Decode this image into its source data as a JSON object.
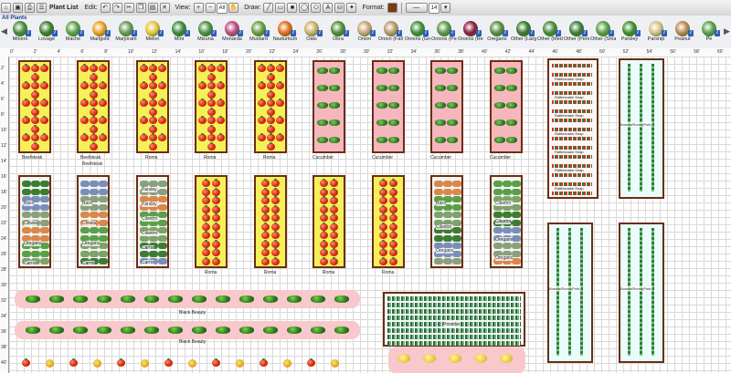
{
  "toolbar": {
    "plant_list": "Plant List",
    "edit_label": "Edit:",
    "view_label": "View:",
    "zoom_value": "All",
    "draw_label": "Draw:",
    "format_label": "Format:",
    "line_width": "14"
  },
  "palette": {
    "filter": "All Plants",
    "items": [
      {
        "label": "Miners",
        "color": "#4b8b3b"
      },
      {
        "label": "Lovage",
        "color": "#3f7f2f"
      },
      {
        "label": "Mache",
        "color": "#5fa04a"
      },
      {
        "label": "Marigold",
        "color": "#f0a020"
      },
      {
        "label": "Marjoram",
        "color": "#6b9a55"
      },
      {
        "label": "Melon",
        "color": "#e8c53b"
      },
      {
        "label": "Mint",
        "color": "#3d8a3b"
      },
      {
        "label": "Mizuna",
        "color": "#4e9142"
      },
      {
        "label": "Monarda",
        "color": "#c24a7b"
      },
      {
        "label": "Mustard",
        "color": "#6a9d3d"
      },
      {
        "label": "Nasturtium",
        "color": "#e86b1c"
      },
      {
        "label": "Oats",
        "color": "#c9b26a"
      },
      {
        "label": "Okra",
        "color": "#4f8f3a"
      },
      {
        "label": "Onion",
        "color": "#c9a77a"
      },
      {
        "label": "Onion (Fall planted)",
        "color": "#b99a6a"
      },
      {
        "label": "Onions (Green)",
        "color": "#3f8f3a"
      },
      {
        "label": "Onions (Perennial)",
        "color": "#5a9a4a"
      },
      {
        "label": "Onions (Red)",
        "color": "#8a1f3f"
      },
      {
        "label": "Oregano",
        "color": "#5b8f3f"
      },
      {
        "label": "Other (Large)",
        "color": "#3a7a30"
      },
      {
        "label": "Other (Medium)",
        "color": "#4a8a3c"
      },
      {
        "label": "Other (Perennial)",
        "color": "#3f7f38"
      },
      {
        "label": "Other (Small)",
        "color": "#5aa048"
      },
      {
        "label": "Parsley",
        "color": "#3e8f2f"
      },
      {
        "label": "Parsnip",
        "color": "#d8c28a"
      },
      {
        "label": "Peanut",
        "color": "#b98a55"
      },
      {
        "label": "Pe",
        "color": "#5aa048"
      }
    ]
  },
  "ruler": {
    "top": [
      "0'",
      "2'",
      "4'",
      "6'",
      "8'",
      "10'",
      "12'",
      "14'",
      "16'",
      "18'",
      "20'",
      "22'",
      "24'",
      "26'",
      "28'",
      "30'",
      "32'",
      "34'",
      "36'",
      "38'",
      "40'",
      "42'",
      "44'",
      "46'",
      "48'",
      "50'",
      "52'",
      "54'",
      "56'",
      "58'",
      "60'",
      "62'"
    ],
    "left": [
      "2'",
      "4'",
      "6'",
      "8'",
      "10'",
      "12'",
      "14'",
      "16'",
      "18'",
      "20'",
      "22'",
      "24'",
      "26'",
      "28'",
      "30'",
      "32'",
      "34'",
      "36'",
      "38'",
      "40'",
      "42'"
    ]
  },
  "beds": {
    "row1_labels": [
      "Beefsteak",
      "Beefsteak",
      "Roma",
      "Roma",
      "Roma",
      "Cucumber",
      "Cucumber",
      "Cucumber",
      "Cucumber"
    ],
    "row1_sub": [
      "",
      "Beefsteak",
      "",
      "",
      "",
      "",
      "",
      "",
      ""
    ],
    "snap_label": "Rattlesnake Snap",
    "pole_label": "Bosnia/Roma(Pole)",
    "pole_label_b": "Bosnia/Roma(Pole)",
    "row2_a": [
      "Basil",
      "Chives",
      "Oregano",
      "Carrot"
    ],
    "row2_b": [
      "Basil",
      "Chives",
      "Oregano",
      "Carrot"
    ],
    "row2_c": [
      "Parsley",
      "Parsley",
      "Cilantro",
      "Cilantro",
      "Carrot",
      "Carrot"
    ],
    "row2_roma": [
      "Roma",
      "Roma",
      "Roma",
      "Roma"
    ],
    "row2_d": [
      "Basil",
      "Cilantro",
      "Oregano"
    ],
    "row2_e": [
      "Cilantro",
      "Cilantro",
      "Oregano",
      "Oregano"
    ],
    "zuke_label_1": "Black Beauty",
    "zuke_label_2": "Black Beauty",
    "beans_label": "Provider"
  }
}
